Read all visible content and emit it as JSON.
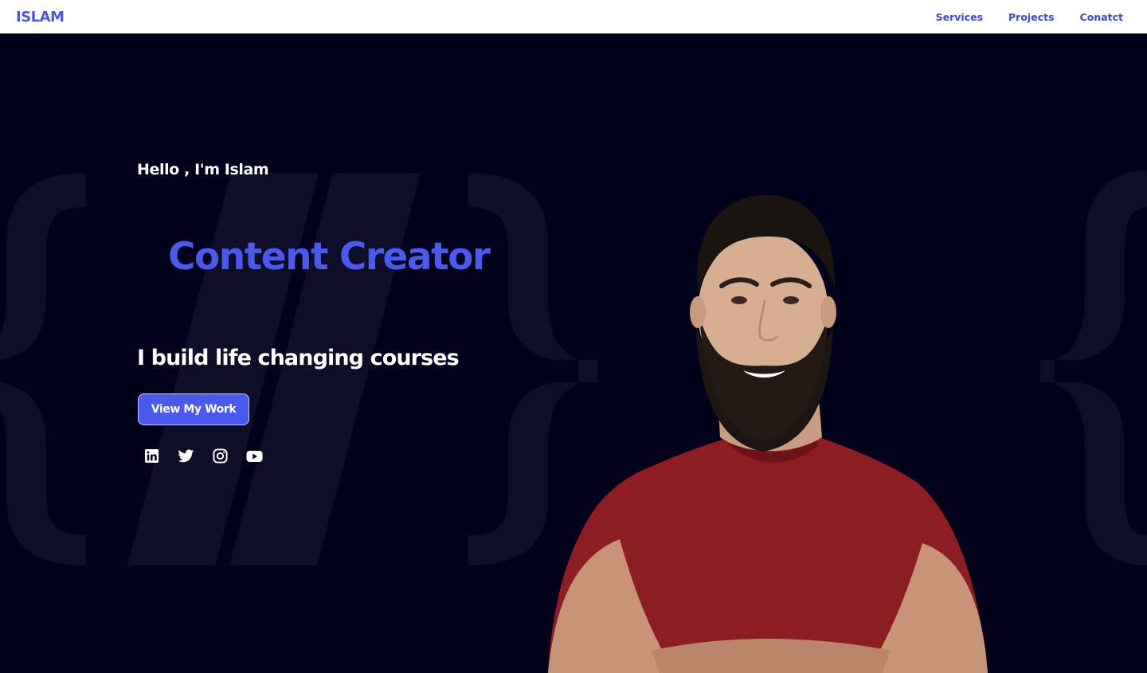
{
  "header": {
    "brand": "ISLAM",
    "nav": [
      {
        "label": "Services"
      },
      {
        "label": "Projects"
      },
      {
        "label": "Conatct"
      }
    ]
  },
  "hero": {
    "greeting": "Hello , I'm Islam",
    "role": "Content Creator",
    "tagline": "I build life changing courses",
    "cta_label": "View My Work",
    "socials": [
      {
        "icon": "linkedin-icon"
      },
      {
        "icon": "twitter-icon"
      },
      {
        "icon": "instagram-icon"
      },
      {
        "icon": "youtube-icon"
      }
    ]
  },
  "colors": {
    "accent": "#4a5aee",
    "background": "#02011c",
    "header_bg": "#ffffff",
    "shirt": "#8c1d21"
  }
}
